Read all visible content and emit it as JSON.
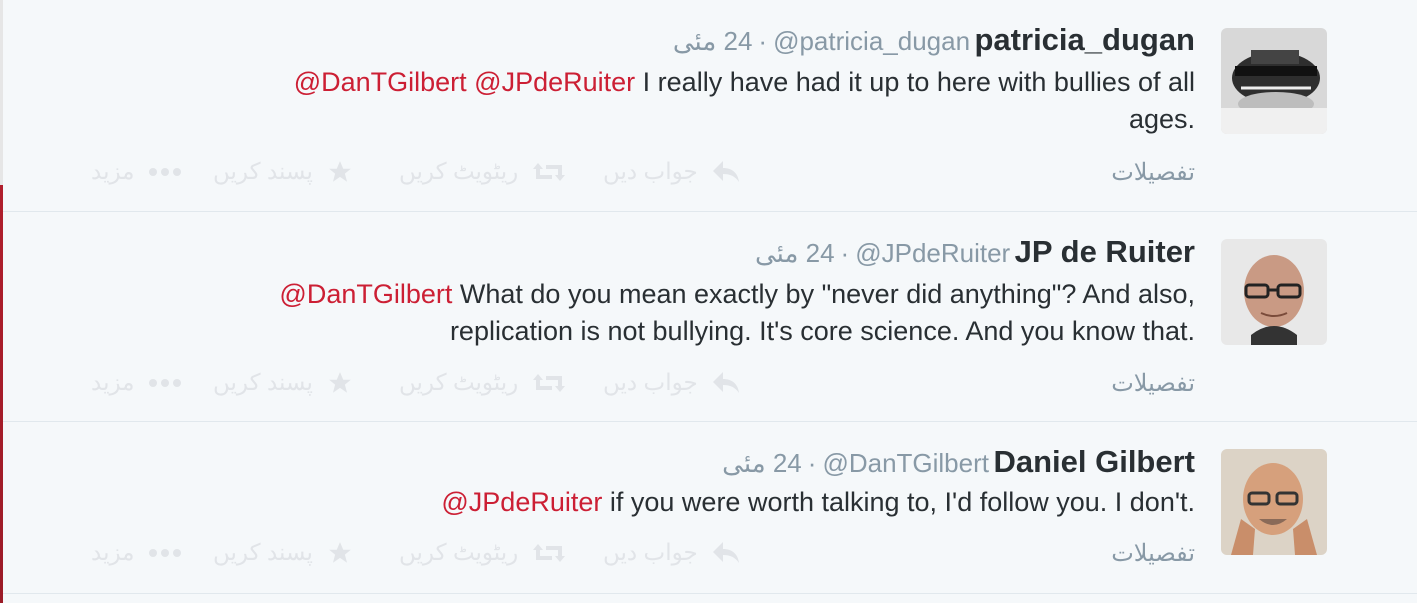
{
  "tweets": [
    {
      "fullname": "patricia_dugan",
      "handle": "@patricia_dugan",
      "time": "24 مئی",
      "mentions": [
        "@DanTGilbert",
        "@JPdeRuiter"
      ],
      "text_line1": "I really have had it up to here with bullies of all",
      "text_line2": "ages."
    },
    {
      "fullname": "JP de Ruiter",
      "handle": "@JPdeRuiter",
      "time": "24 مئی",
      "mentions": [
        "@DanTGilbert"
      ],
      "text_line1": "What do you mean exactly by \"never did anything\"? And also,",
      "text_line2": "replication is not bullying. It's core science. And you know that."
    },
    {
      "fullname": "Daniel Gilbert",
      "handle": "@DanTGilbert",
      "time": "24 مئی",
      "mentions": [
        "@JPdeRuiter"
      ],
      "text_line1": "if you were worth talking to, I'd follow you. I don't.",
      "text_line2": ""
    }
  ],
  "actions": {
    "details": "تفصیلات",
    "reply": "جواب دیں",
    "retweet": "ریٹویٹ کریں",
    "favorite": "پسند کریں",
    "more": "مزید"
  },
  "icons": [
    "reply-icon",
    "retweet-icon",
    "star-icon",
    "more-dots-icon"
  ],
  "colors": {
    "mention": "#cc1f34",
    "muted": "#8899a6",
    "text": "#292f33",
    "background": "#f5f8fa"
  }
}
